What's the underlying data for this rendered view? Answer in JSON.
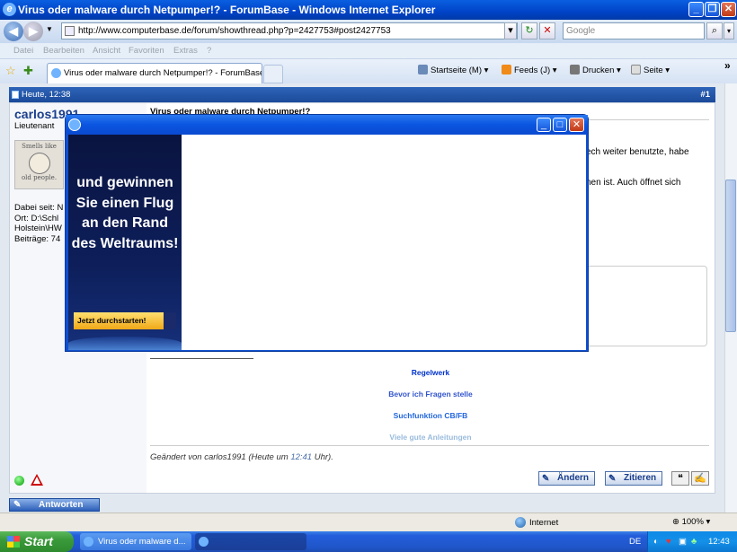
{
  "window": {
    "title": "Virus oder malware durch Netpumper!? - ForumBase - Windows Internet Explorer"
  },
  "address": {
    "url": "http://www.computerbase.de/forum/showthread.php?p=2427753#post2427753",
    "search_placeholder": "Google"
  },
  "menu": [
    "Datei",
    "Bearbeiten",
    "Ansicht",
    "Favoriten",
    "Extras",
    "?"
  ],
  "tab": {
    "title": "Virus oder malware durch Netpumper!? - ForumBase"
  },
  "toolbar": {
    "home": "Startseite (M)",
    "feeds": "Feeds (J)",
    "print": "Drucken",
    "page": "Seite"
  },
  "post": {
    "date": "Heute, 12:38",
    "number": "#1",
    "username": "carlos1991",
    "rank": "Lieutenant",
    "avatar_text_top": "Smells like",
    "avatar_text_bottom": "old people.",
    "userinfo": "Dabei seit: N\nOrt: D:\\Schl\nHolstein\\HW\nBeiträge: 74",
    "title": "Virus oder malware durch Netpumper!?",
    "line1": "ech weiter benutzte, habe",
    "line2": "nen ist. Auch öffnet sich",
    "signature_links": [
      {
        "text": "Regelwerk",
        "color": "#0033cc"
      },
      {
        "text": "Bevor ich Fragen stelle",
        "color": "#3355cc"
      },
      {
        "text": "Suchfunktion CB/FB",
        "color": "#2266dd"
      },
      {
        "text": "Viele gute Anleitungen",
        "color": "#99bbdd"
      }
    ],
    "edited_prefix": "Geändert von carlos1991 (Heute um ",
    "edited_time": "12:41",
    "edited_suffix": " Uhr).",
    "btn_edit": "Ändern",
    "btn_quote": "Zitieren"
  },
  "reply_label": "Antworten",
  "status": {
    "zone": "Internet",
    "zoom": "100%"
  },
  "popup": {
    "ad_text": "und gewinnen Sie einen Flug an den Rand des Weltraums!",
    "ad_button": "Jetzt durchstarten!"
  },
  "taskbar": {
    "start": "Start",
    "task1": "Virus oder malware d...",
    "lang": "DE",
    "clock": "12:43"
  }
}
